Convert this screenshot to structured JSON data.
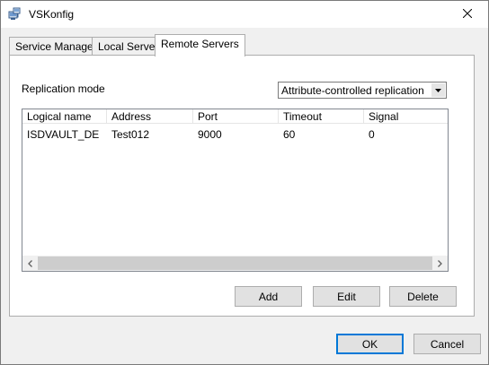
{
  "window": {
    "title": "VSKonfig",
    "icon": "server-icon",
    "close_icon": "close-icon"
  },
  "tabs": [
    {
      "label": "Service Manager",
      "active": false
    },
    {
      "label": "Local Server",
      "active": false
    },
    {
      "label": "Remote Servers",
      "active": true
    }
  ],
  "replication": {
    "label": "Replication mode",
    "selected": "Attribute-controlled replication"
  },
  "table": {
    "columns": [
      "Logical name",
      "Address",
      "Port",
      "Timeout",
      "Signal"
    ],
    "rows": [
      [
        "ISDVAULT_DE",
        "Test012",
        "9000",
        "60",
        "0"
      ]
    ]
  },
  "panel_buttons": {
    "add": "Add",
    "edit": "Edit",
    "delete": "Delete"
  },
  "dialog_buttons": {
    "ok": "OK",
    "cancel": "Cancel"
  },
  "colors": {
    "focus_border": "#0078d7",
    "button_face": "#e1e1e1",
    "dialog_bg": "#f0f0f0"
  }
}
